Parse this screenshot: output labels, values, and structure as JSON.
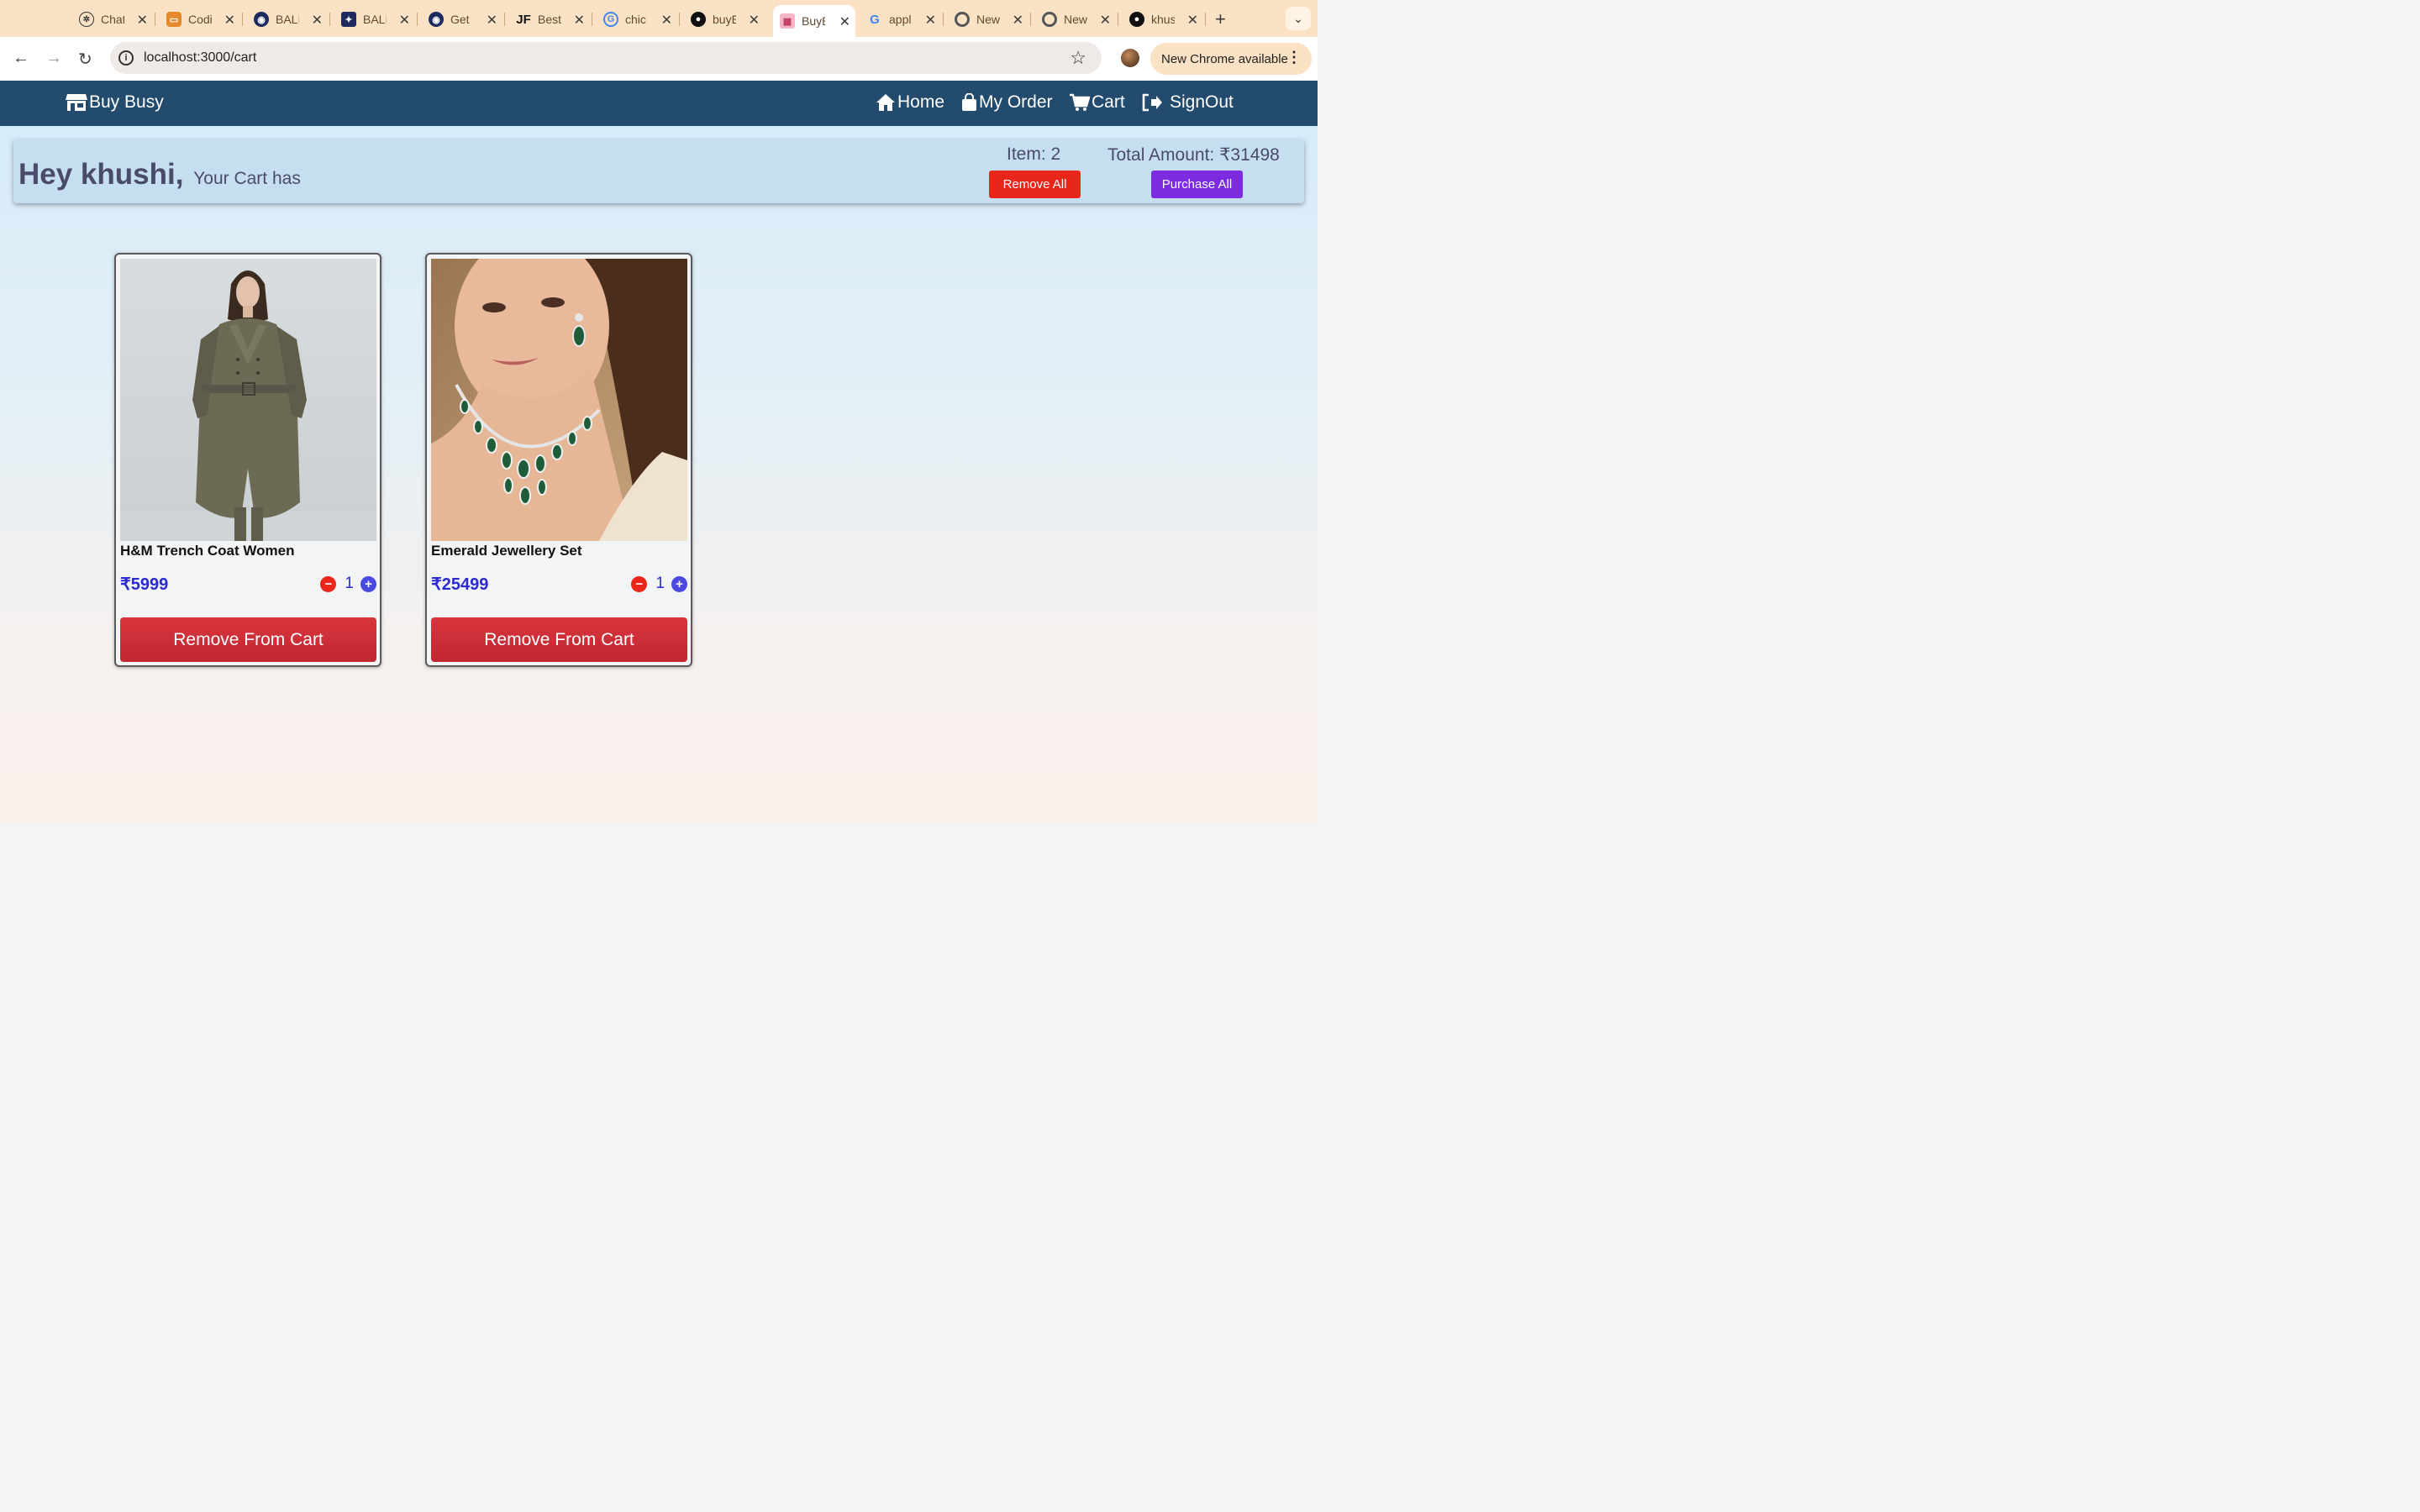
{
  "browser": {
    "tabs": [
      {
        "title": "Chat",
        "icon": "chatgpt-icon",
        "color": "#333333",
        "active": false
      },
      {
        "title": "Codi",
        "icon": "codingninjas-icon",
        "color": "#e58a2b",
        "active": false
      },
      {
        "title": "BALI",
        "icon": "bali-icon",
        "color": "#1d2a5e",
        "active": false
      },
      {
        "title": "BALI",
        "icon": "bali-icon",
        "color": "#1d2a5e",
        "active": false
      },
      {
        "title": "Get",
        "icon": "bali-icon",
        "color": "#1d2a5e",
        "active": false
      },
      {
        "title": "Best",
        "icon": "jf-icon",
        "color": "#111111",
        "active": false
      },
      {
        "title": "chic",
        "icon": "google-icon",
        "color": "#4285f4",
        "active": false
      },
      {
        "title": "buyE",
        "icon": "github-icon",
        "color": "#111111",
        "active": false
      },
      {
        "title": "BuyE",
        "icon": "store-icon",
        "color": "#e66a8a",
        "active": true
      },
      {
        "title": "appl",
        "icon": "google-icon",
        "color": "#4285f4",
        "active": false
      },
      {
        "title": "New",
        "icon": "chrome-icon",
        "color": "#555555",
        "active": false
      },
      {
        "title": "New",
        "icon": "chrome-icon",
        "color": "#555555",
        "active": false
      },
      {
        "title": "khus",
        "icon": "github-icon",
        "color": "#111111",
        "active": false
      }
    ],
    "url": "localhost:3000/cart",
    "update_label": "New Chrome available"
  },
  "nav": {
    "brand": "Buy Busy",
    "home": "Home",
    "orders": "My Order",
    "cart": "Cart",
    "signout": "SignOut"
  },
  "summary": {
    "greeting": "Hey khushi,",
    "subtitle": "Your Cart has",
    "items_label": "Item: 2",
    "total_label": "Total Amount: ₹31498",
    "remove_all": "Remove All",
    "purchase_all": "Purchase All"
  },
  "products": [
    {
      "name": "H&M Trench Coat Women",
      "price": "₹5999",
      "qty": "1",
      "remove_label": "Remove From Cart",
      "minus": "−",
      "plus": "+"
    },
    {
      "name": "Emerald Jewellery Set",
      "price": "₹25499",
      "qty": "1",
      "remove_label": "Remove From Cart",
      "minus": "−",
      "plus": "+"
    }
  ],
  "colors": {
    "navbar": "#224b6e",
    "remove_all": "#e8261a",
    "purchase_all": "#7d2be0",
    "remove_from_cart": "#c9303a",
    "price": "#2a2ad0"
  }
}
